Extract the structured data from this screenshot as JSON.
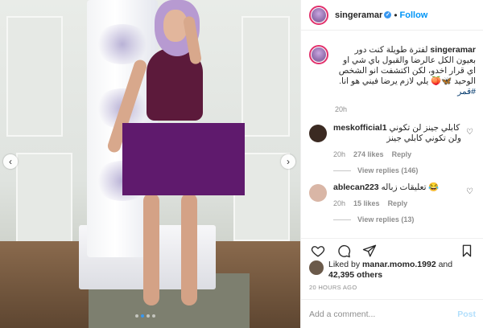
{
  "post": {
    "username": "singeramar",
    "follow_label": "Follow",
    "separator": "•",
    "verified_icon": "verified-badge-icon"
  },
  "caption": {
    "username": "singeramar",
    "text": "لفترة طويلة كنت دور بعيون الكل عالرضا والقبول باي شي او اي قرار اخدو، لكن اكتشفت انو الشخص الوحيد 🦋🍑 يلي لازم يرضا فيني هو انا.",
    "hashtag": "#قمر",
    "time": "20h"
  },
  "comments": [
    {
      "username": "meskofficial1",
      "text_line1": "كابلي جينز لن تكوني",
      "text_line2": "ولن تكوني كابلي جينز",
      "time": "20h",
      "likes": "274 likes",
      "reply_label": "Reply",
      "view_replies": "View replies (146)"
    },
    {
      "username": "ablecan223",
      "text": "تعليقات زباله 😂",
      "time": "20h",
      "likes": "15 likes",
      "reply_label": "Reply",
      "view_replies": "View replies (13)"
    }
  ],
  "likes": {
    "liked_by_prefix": "Liked by",
    "liked_by_user": "manar.momo.1992",
    "and": "and",
    "others": "42,395 others"
  },
  "timestamp": "20 HOURS AGO",
  "add_comment": {
    "placeholder": "Add a comment...",
    "post_label": "Post"
  },
  "photo": {
    "prev_glyph": "‹",
    "next_glyph": "›",
    "carousel_count": 4,
    "carousel_active": 1
  },
  "colors": {
    "accent_blue": "#0095f6",
    "censor_purple": "#5f1a6d",
    "muted": "#8e8e8e"
  }
}
